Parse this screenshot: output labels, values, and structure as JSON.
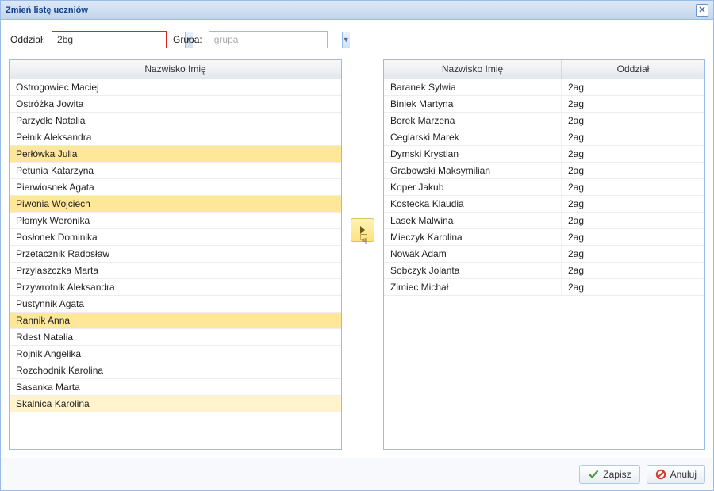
{
  "title": "Zmień listę uczniów",
  "filters": {
    "oddzial_label": "Oddział:",
    "oddzial_value": "2bg",
    "grupa_label": "Grupa:",
    "grupa_placeholder": "grupa"
  },
  "left_grid": {
    "header_name": "Nazwisko Imię",
    "rows": [
      {
        "name": "Ostrogowiec Maciej",
        "sel": ""
      },
      {
        "name": "Ostróżka Jowita",
        "sel": ""
      },
      {
        "name": "Parzydło Natalia",
        "sel": ""
      },
      {
        "name": "Pełnik Aleksandra",
        "sel": ""
      },
      {
        "name": "Perłówka Julia",
        "sel": "sel-strong"
      },
      {
        "name": "Petunia Katarzyna",
        "sel": ""
      },
      {
        "name": "Pierwiosnek Agata",
        "sel": ""
      },
      {
        "name": "Piwonia Wojciech",
        "sel": "sel-strong"
      },
      {
        "name": "Płomyk Weronika",
        "sel": ""
      },
      {
        "name": "Posłonek Dominika",
        "sel": ""
      },
      {
        "name": "Przetacznik Radosław",
        "sel": ""
      },
      {
        "name": "Przylaszczka Marta",
        "sel": ""
      },
      {
        "name": "Przywrotnik Aleksandra",
        "sel": ""
      },
      {
        "name": "Pustynnik Agata",
        "sel": ""
      },
      {
        "name": "Rannik Anna",
        "sel": "sel-strong"
      },
      {
        "name": "Rdest Natalia",
        "sel": ""
      },
      {
        "name": "Rojnik Angelika",
        "sel": ""
      },
      {
        "name": "Rozchodnik Karolina",
        "sel": ""
      },
      {
        "name": "Sasanka Marta",
        "sel": ""
      },
      {
        "name": "Skalnica Karolina",
        "sel": "sel-light"
      }
    ]
  },
  "right_grid": {
    "header_name": "Nazwisko Imię",
    "header_dept": "Oddział",
    "rows": [
      {
        "name": "Baranek Sylwia",
        "dept": "2ag"
      },
      {
        "name": "Biniek Martyna",
        "dept": "2ag"
      },
      {
        "name": "Borek Marzena",
        "dept": "2ag"
      },
      {
        "name": "Ceglarski Marek",
        "dept": "2ag"
      },
      {
        "name": "Dymski Krystian",
        "dept": "2ag"
      },
      {
        "name": "Grabowski Maksymilian",
        "dept": "2ag"
      },
      {
        "name": "Koper Jakub",
        "dept": "2ag"
      },
      {
        "name": "Kostecka Klaudia",
        "dept": "2ag"
      },
      {
        "name": "Lasek Malwina",
        "dept": "2ag"
      },
      {
        "name": "Mieczyk Karolina",
        "dept": "2ag"
      },
      {
        "name": "Nowak Adam",
        "dept": "2ag"
      },
      {
        "name": "Sobczyk Jolanta",
        "dept": "2ag"
      },
      {
        "name": "Zimiec Michał",
        "dept": "2ag"
      }
    ]
  },
  "buttons": {
    "save": "Zapisz",
    "cancel": "Anuluj"
  }
}
